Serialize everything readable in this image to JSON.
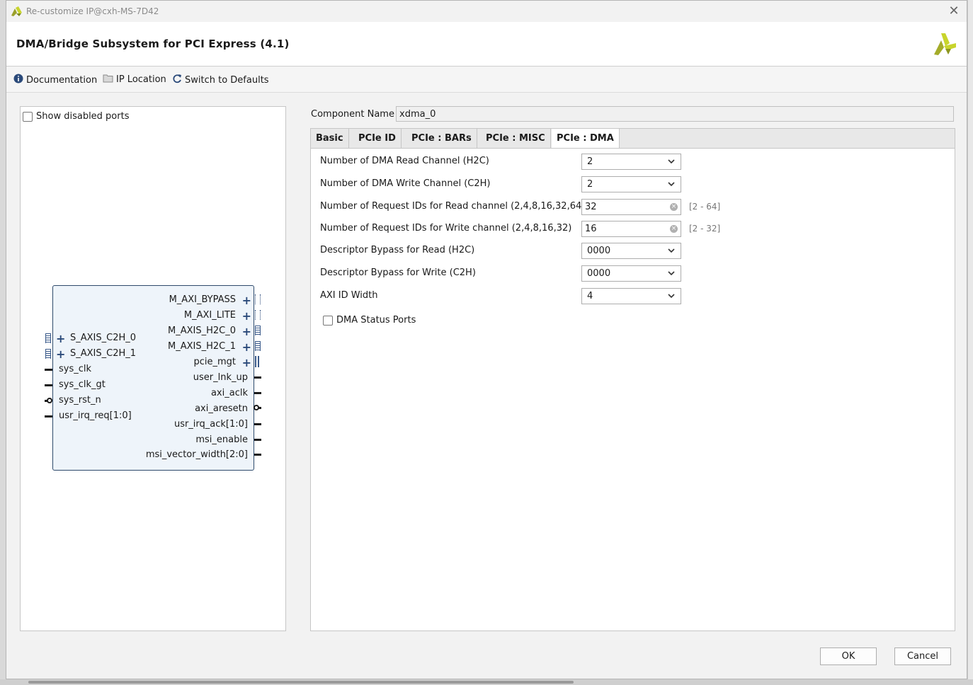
{
  "window": {
    "title": "Re-customize IP@cxh-MS-7D42",
    "close_glyph": "✕"
  },
  "header": {
    "title": "DMA/Bridge Subsystem for PCI Express (4.1)"
  },
  "toolbar": {
    "documentation": "Documentation",
    "ip_location": "IP Location",
    "switch_defaults": "Switch to Defaults"
  },
  "left_panel": {
    "show_disabled_ports": "Show disabled ports",
    "left_ports": [
      "S_AXIS_C2H_0",
      "S_AXIS_C2H_1",
      "sys_clk",
      "sys_clk_gt",
      "sys_rst_n",
      "usr_irq_req[1:0]"
    ],
    "right_ports": [
      "M_AXI_BYPASS",
      "M_AXI_LITE",
      "M_AXIS_H2C_0",
      "M_AXIS_H2C_1",
      "pcie_mgt",
      "user_lnk_up",
      "axi_aclk",
      "axi_aresetn",
      "usr_irq_ack[1:0]",
      "msi_enable",
      "msi_vector_width[2:0]"
    ]
  },
  "component": {
    "label": "Component Name",
    "value": "xdma_0"
  },
  "tabs": [
    "Basic",
    "PCIe ID",
    "PCIe : BARs",
    "PCIe : MISC",
    "PCIe : DMA"
  ],
  "dma": {
    "read_channel_label": "Number of DMA Read Channel (H2C)",
    "read_channel_value": "2",
    "write_channel_label": "Number of DMA Write Channel (C2H)",
    "write_channel_value": "2",
    "req_ids_read_label": "Number of Request IDs for Read channel (2,4,8,16,32,64)",
    "req_ids_read_value": "32",
    "req_ids_read_range": "[2 - 64]",
    "req_ids_write_label": "Number of Request IDs for Write channel (2,4,8,16,32)",
    "req_ids_write_value": "16",
    "req_ids_write_range": "[2 - 32]",
    "bypass_read_label": "Descriptor Bypass for Read (H2C)",
    "bypass_read_value": "0000",
    "bypass_write_label": "Descriptor Bypass for Write (C2H)",
    "bypass_write_value": "0000",
    "axi_id_width_label": "AXI ID Width",
    "axi_id_width_value": "4",
    "status_ports_label": "DMA Status Ports"
  },
  "buttons": {
    "ok": "OK",
    "cancel": "Cancel"
  },
  "colors": {
    "brand_yellow": "#c8d42c",
    "symbol_fill": "#eef4fa",
    "symbol_border": "#2e4a6b"
  }
}
